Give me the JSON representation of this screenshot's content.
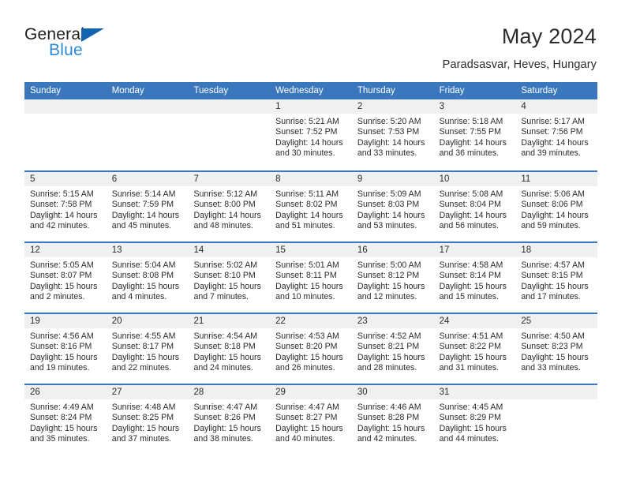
{
  "brand": {
    "name_top": "General",
    "name_bottom": "Blue",
    "accent_color": "#1263b0",
    "accent_color_light": "#2e8ad6"
  },
  "header": {
    "title": "May 2024",
    "subtitle": "Paradsasvar, Heves, Hungary"
  },
  "theme": {
    "header_row_bg": "#3a77bd",
    "daynum_strip_bg": "#f0f0f0",
    "text_color": "#2b2b2b"
  },
  "calendar": {
    "weekday_headers": [
      "Sunday",
      "Monday",
      "Tuesday",
      "Wednesday",
      "Thursday",
      "Friday",
      "Saturday"
    ],
    "weeks": [
      [
        {
          "day": "",
          "empty": true
        },
        {
          "day": "",
          "empty": true
        },
        {
          "day": "",
          "empty": true
        },
        {
          "day": "1",
          "sunrise": "Sunrise: 5:21 AM",
          "sunset": "Sunset: 7:52 PM",
          "daylight": "Daylight: 14 hours and 30 minutes."
        },
        {
          "day": "2",
          "sunrise": "Sunrise: 5:20 AM",
          "sunset": "Sunset: 7:53 PM",
          "daylight": "Daylight: 14 hours and 33 minutes."
        },
        {
          "day": "3",
          "sunrise": "Sunrise: 5:18 AM",
          "sunset": "Sunset: 7:55 PM",
          "daylight": "Daylight: 14 hours and 36 minutes."
        },
        {
          "day": "4",
          "sunrise": "Sunrise: 5:17 AM",
          "sunset": "Sunset: 7:56 PM",
          "daylight": "Daylight: 14 hours and 39 minutes."
        }
      ],
      [
        {
          "day": "5",
          "sunrise": "Sunrise: 5:15 AM",
          "sunset": "Sunset: 7:58 PM",
          "daylight": "Daylight: 14 hours and 42 minutes."
        },
        {
          "day": "6",
          "sunrise": "Sunrise: 5:14 AM",
          "sunset": "Sunset: 7:59 PM",
          "daylight": "Daylight: 14 hours and 45 minutes."
        },
        {
          "day": "7",
          "sunrise": "Sunrise: 5:12 AM",
          "sunset": "Sunset: 8:00 PM",
          "daylight": "Daylight: 14 hours and 48 minutes."
        },
        {
          "day": "8",
          "sunrise": "Sunrise: 5:11 AM",
          "sunset": "Sunset: 8:02 PM",
          "daylight": "Daylight: 14 hours and 51 minutes."
        },
        {
          "day": "9",
          "sunrise": "Sunrise: 5:09 AM",
          "sunset": "Sunset: 8:03 PM",
          "daylight": "Daylight: 14 hours and 53 minutes."
        },
        {
          "day": "10",
          "sunrise": "Sunrise: 5:08 AM",
          "sunset": "Sunset: 8:04 PM",
          "daylight": "Daylight: 14 hours and 56 minutes."
        },
        {
          "day": "11",
          "sunrise": "Sunrise: 5:06 AM",
          "sunset": "Sunset: 8:06 PM",
          "daylight": "Daylight: 14 hours and 59 minutes."
        }
      ],
      [
        {
          "day": "12",
          "sunrise": "Sunrise: 5:05 AM",
          "sunset": "Sunset: 8:07 PM",
          "daylight": "Daylight: 15 hours and 2 minutes."
        },
        {
          "day": "13",
          "sunrise": "Sunrise: 5:04 AM",
          "sunset": "Sunset: 8:08 PM",
          "daylight": "Daylight: 15 hours and 4 minutes."
        },
        {
          "day": "14",
          "sunrise": "Sunrise: 5:02 AM",
          "sunset": "Sunset: 8:10 PM",
          "daylight": "Daylight: 15 hours and 7 minutes."
        },
        {
          "day": "15",
          "sunrise": "Sunrise: 5:01 AM",
          "sunset": "Sunset: 8:11 PM",
          "daylight": "Daylight: 15 hours and 10 minutes."
        },
        {
          "day": "16",
          "sunrise": "Sunrise: 5:00 AM",
          "sunset": "Sunset: 8:12 PM",
          "daylight": "Daylight: 15 hours and 12 minutes."
        },
        {
          "day": "17",
          "sunrise": "Sunrise: 4:58 AM",
          "sunset": "Sunset: 8:14 PM",
          "daylight": "Daylight: 15 hours and 15 minutes."
        },
        {
          "day": "18",
          "sunrise": "Sunrise: 4:57 AM",
          "sunset": "Sunset: 8:15 PM",
          "daylight": "Daylight: 15 hours and 17 minutes."
        }
      ],
      [
        {
          "day": "19",
          "sunrise": "Sunrise: 4:56 AM",
          "sunset": "Sunset: 8:16 PM",
          "daylight": "Daylight: 15 hours and 19 minutes."
        },
        {
          "day": "20",
          "sunrise": "Sunrise: 4:55 AM",
          "sunset": "Sunset: 8:17 PM",
          "daylight": "Daylight: 15 hours and 22 minutes."
        },
        {
          "day": "21",
          "sunrise": "Sunrise: 4:54 AM",
          "sunset": "Sunset: 8:18 PM",
          "daylight": "Daylight: 15 hours and 24 minutes."
        },
        {
          "day": "22",
          "sunrise": "Sunrise: 4:53 AM",
          "sunset": "Sunset: 8:20 PM",
          "daylight": "Daylight: 15 hours and 26 minutes."
        },
        {
          "day": "23",
          "sunrise": "Sunrise: 4:52 AM",
          "sunset": "Sunset: 8:21 PM",
          "daylight": "Daylight: 15 hours and 28 minutes."
        },
        {
          "day": "24",
          "sunrise": "Sunrise: 4:51 AM",
          "sunset": "Sunset: 8:22 PM",
          "daylight": "Daylight: 15 hours and 31 minutes."
        },
        {
          "day": "25",
          "sunrise": "Sunrise: 4:50 AM",
          "sunset": "Sunset: 8:23 PM",
          "daylight": "Daylight: 15 hours and 33 minutes."
        }
      ],
      [
        {
          "day": "26",
          "sunrise": "Sunrise: 4:49 AM",
          "sunset": "Sunset: 8:24 PM",
          "daylight": "Daylight: 15 hours and 35 minutes."
        },
        {
          "day": "27",
          "sunrise": "Sunrise: 4:48 AM",
          "sunset": "Sunset: 8:25 PM",
          "daylight": "Daylight: 15 hours and 37 minutes."
        },
        {
          "day": "28",
          "sunrise": "Sunrise: 4:47 AM",
          "sunset": "Sunset: 8:26 PM",
          "daylight": "Daylight: 15 hours and 38 minutes."
        },
        {
          "day": "29",
          "sunrise": "Sunrise: 4:47 AM",
          "sunset": "Sunset: 8:27 PM",
          "daylight": "Daylight: 15 hours and 40 minutes."
        },
        {
          "day": "30",
          "sunrise": "Sunrise: 4:46 AM",
          "sunset": "Sunset: 8:28 PM",
          "daylight": "Daylight: 15 hours and 42 minutes."
        },
        {
          "day": "31",
          "sunrise": "Sunrise: 4:45 AM",
          "sunset": "Sunset: 8:29 PM",
          "daylight": "Daylight: 15 hours and 44 minutes."
        },
        {
          "day": "",
          "empty": true
        }
      ]
    ]
  }
}
